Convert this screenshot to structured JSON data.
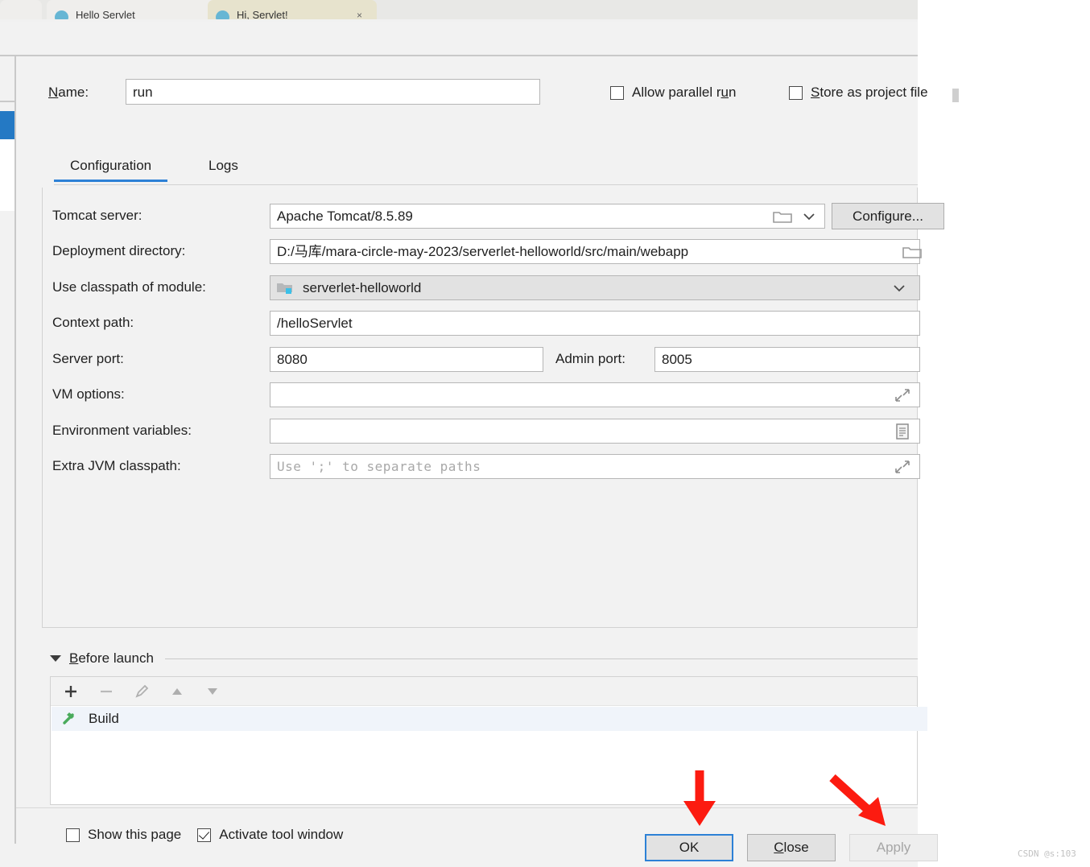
{
  "browser": {
    "tabs": [
      {
        "title": "Hello Servlet",
        "active": false,
        "close_label": "×"
      },
      {
        "title": "Hi, Servlet!",
        "active": true,
        "close_label": "×"
      }
    ]
  },
  "dialog": {
    "name_label": "Name:",
    "name_label_mnemonic": "N",
    "name_value": "run",
    "top_checkboxes": [
      {
        "label": "Allow parallel run",
        "mnemonic": "u",
        "checked": false
      },
      {
        "label": "Store as project file",
        "mnemonic": "S",
        "checked": false
      }
    ],
    "tabs": [
      {
        "label": "Configuration",
        "active": true
      },
      {
        "label": "Logs",
        "active": false
      }
    ],
    "fields": {
      "tomcat_server": {
        "label": "Tomcat server:",
        "value": "Apache Tomcat/8.5.89",
        "folder_icon": "folder-icon",
        "chevron_icon": "chevron-down-icon",
        "configure_button": "Configure..."
      },
      "deployment_directory": {
        "label": "Deployment directory:",
        "value": "D:/马库/mara-circle-may-2023/serverlet-helloworld/src/main/webapp",
        "folder_icon": "folder-icon"
      },
      "use_classpath_of_module": {
        "label": "Use classpath of module:",
        "value": "serverlet-helloworld",
        "module_icon": "module-folder-icon",
        "chevron_icon": "chevron-down-icon"
      },
      "context_path": {
        "label": "Context path:",
        "value": "/helloServlet"
      },
      "server_port": {
        "label": "Server port:",
        "value": "8080"
      },
      "admin_port": {
        "label": "Admin port:",
        "value": "8005"
      },
      "vm_options": {
        "label": "VM options:",
        "value": "",
        "expand_icon": "expand-arrows-icon"
      },
      "environment_variables": {
        "label": "Environment variables:",
        "value": "",
        "browse_icon": "list-browse-icon"
      },
      "extra_jvm_classpath": {
        "label": "Extra JVM classpath:",
        "value": "",
        "placeholder": "Use ';' to separate paths",
        "expand_icon": "expand-arrows-icon"
      }
    },
    "before_launch": {
      "title": "Before launch",
      "mnemonic": "B",
      "collapse_icon": "triangle-down-icon",
      "toolbar": [
        {
          "name": "add-icon",
          "enabled": true
        },
        {
          "name": "remove-icon",
          "enabled": false
        },
        {
          "name": "edit-pencil-icon",
          "enabled": false
        },
        {
          "name": "move-up-icon",
          "enabled": true
        },
        {
          "name": "move-down-icon",
          "enabled": true
        }
      ],
      "items": [
        {
          "label": "Build",
          "icon": "hammer-icon"
        }
      ]
    },
    "bottom_checkboxes": [
      {
        "label": "Show this page",
        "checked": false
      },
      {
        "label": "Activate tool window",
        "checked": true
      }
    ],
    "buttons": [
      {
        "label": "OK",
        "state": "default",
        "mnemonic": ""
      },
      {
        "label": "Close",
        "state": "normal",
        "mnemonic": "C"
      },
      {
        "label": "Apply",
        "state": "disabled",
        "mnemonic": ""
      }
    ]
  },
  "annotations": {
    "arrow_color": "#fc1b10",
    "arrows": [
      {
        "name": "arrow-pointing-to-ok",
        "target": "OK"
      },
      {
        "name": "arrow-pointing-to-apply",
        "target": "Apply"
      }
    ]
  },
  "watermark": "CSDN @s:103"
}
